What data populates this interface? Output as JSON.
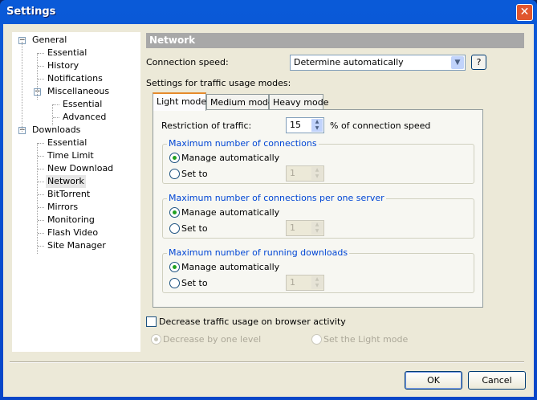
{
  "window": {
    "title": "Settings",
    "close": "✕"
  },
  "tree": [
    {
      "label": "General",
      "level": 0,
      "expanded": true
    },
    {
      "label": "Essential",
      "level": 1
    },
    {
      "label": "History",
      "level": 1
    },
    {
      "label": "Notifications",
      "level": 1
    },
    {
      "label": "Miscellaneous",
      "level": 1,
      "expanded": true
    },
    {
      "label": "Essential",
      "level": 2
    },
    {
      "label": "Advanced",
      "level": 2
    },
    {
      "label": "Downloads",
      "level": 0,
      "expanded": true
    },
    {
      "label": "Essential",
      "level": 1
    },
    {
      "label": "Time Limit",
      "level": 1
    },
    {
      "label": "New Download",
      "level": 1
    },
    {
      "label": "Network",
      "level": 1,
      "selected": true
    },
    {
      "label": "BitTorrent",
      "level": 1
    },
    {
      "label": "Mirrors",
      "level": 1
    },
    {
      "label": "Monitoring",
      "level": 1
    },
    {
      "label": "Flash Video",
      "level": 1
    },
    {
      "label": "Site Manager",
      "level": 1
    }
  ],
  "main": {
    "header": "Network",
    "connection_label": "Connection speed:",
    "connection_value": "Determine automatically",
    "help": "?",
    "modes_label": "Settings for traffic usage modes:",
    "tabs": [
      "Light mode",
      "Medium mode",
      "Heavy mode"
    ],
    "restriction_label": "Restriction of traffic:",
    "restriction_value": "15",
    "restriction_suffix": "% of connection speed",
    "groups": [
      {
        "title": "Maximum number of connections",
        "auto": "Manage automatically",
        "set": "Set to",
        "value": "1"
      },
      {
        "title": "Maximum number of connections per one server",
        "auto": "Manage automatically",
        "set": "Set to",
        "value": "1"
      },
      {
        "title": "Maximum number of running downloads",
        "auto": "Manage automatically",
        "set": "Set to",
        "value": "1"
      }
    ],
    "browser_check": "Decrease traffic usage on browser activity",
    "opt1": "Decrease by one level",
    "opt2": "Set the Light mode"
  },
  "buttons": {
    "ok": "OK",
    "cancel": "Cancel"
  }
}
